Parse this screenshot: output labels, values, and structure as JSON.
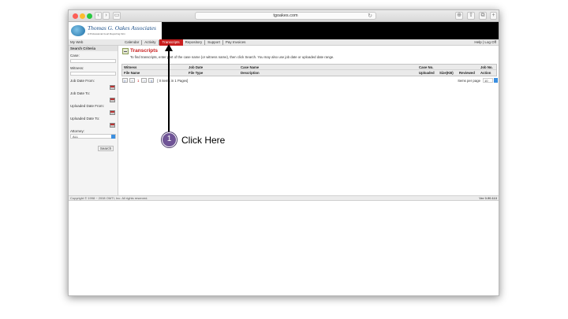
{
  "browser": {
    "url": "tgoakes.com",
    "back_glyph": "‹",
    "forward_glyph": "›",
    "reload_glyph": "↻"
  },
  "brand": {
    "name": "Thomas G. Oakes Associates",
    "tagline": "A Professional Court Reporting Firm"
  },
  "nav": {
    "myweb": "My Web",
    "tabs": [
      "Calendar",
      "Activity",
      "Transcripts",
      "Repository",
      "Support",
      "Pay Invoices"
    ],
    "active_tab": "Transcripts",
    "right": "Help | Log Off"
  },
  "sidebar": {
    "heading": "Search Criteria",
    "case_label": "Case:",
    "witness_label": "Witness:",
    "job_date_from_label": "Job Date From:",
    "job_date_to_label": "Job Date To:",
    "uploaded_from_label": "Uploaded Date From:",
    "uploaded_to_label": "Uploaded Date To:",
    "attorney_label": "Attorney:",
    "attorney_value": "ALL",
    "search_button": "Search"
  },
  "main": {
    "title": "Transcripts",
    "instructions": "To find transcripts, enter part of the case name (or witness name), then click Search. You may also use job date or uploaded date range.",
    "columns_row1": [
      "Witness",
      "Job Date",
      "Case Name",
      "Case No.",
      "",
      "",
      "Job No."
    ],
    "columns_row2": [
      "File Name",
      "File Type",
      "Description",
      "Uploaded",
      "Size(KB)",
      "Reviewed",
      "Action"
    ],
    "pager": {
      "first": "|‹",
      "prev": "‹",
      "current": "1",
      "next": "›",
      "last": "›|",
      "info": "[ 0 items in 1 Pages]"
    },
    "items_per_page_label": "Items per page",
    "items_per_page_value": "10"
  },
  "footer": {
    "copyright": "Copyright © 1998 ~ 2008 OMTI, Inc. All rights reserved.",
    "version": "Ver 0.90.113"
  },
  "annotation": {
    "step_number": "1",
    "text": "Click Here",
    "badge_color": "#6f5496"
  },
  "colors": {
    "accent_red": "#c81e1e",
    "banner": "#000000"
  }
}
